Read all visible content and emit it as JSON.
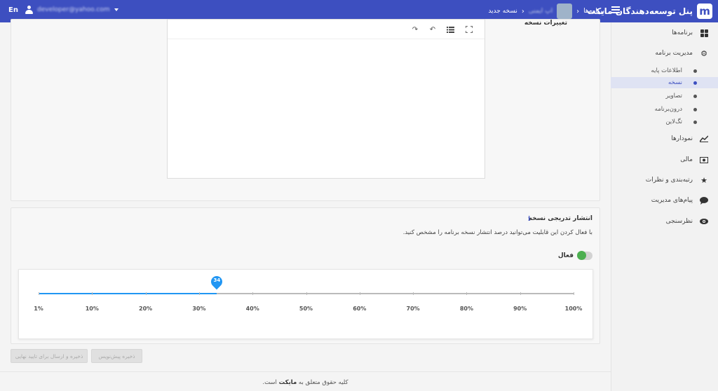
{
  "header": {
    "brand_title": "پنل توسعه‌دهندگان مایکت",
    "breadcrumb_apps": "برنامه‌ها",
    "breadcrumb_app_name": "اپ ایمنی",
    "breadcrumb_current": "نسخه جدید",
    "lang": "En",
    "user_email": "developer@yahoo.com"
  },
  "sidebar": {
    "items": [
      {
        "label": "برنامه‌ها",
        "icon": "grid-icon"
      },
      {
        "label": "مدیریت برنامه",
        "icon": "gear-icon"
      },
      {
        "label": "نمودارها",
        "icon": "chart-icon"
      },
      {
        "label": "مالی",
        "icon": "money-icon"
      },
      {
        "label": "رتبه‌بندی و نظرات",
        "icon": "star-icon"
      },
      {
        "label": "پیام‌های مدیریت",
        "icon": "chat-icon"
      },
      {
        "label": "نظرسنجی",
        "icon": "eye-icon"
      }
    ],
    "subitems": [
      {
        "label": "اطلاعات پایه"
      },
      {
        "label": "نسخه",
        "active": true
      },
      {
        "label": "تصاویر"
      },
      {
        "label": "درون‌برنامه"
      },
      {
        "label": "تگ‌لاین"
      }
    ]
  },
  "notes": {
    "title": "تغییرات نسخه"
  },
  "release": {
    "title": "انتشار تدریجی نسخه",
    "description": "با فعال کردن این قابلیت می‌توانید درصد انتشار نسخه برنامه را مشخص کنید.",
    "toggle_label": "فعال",
    "toggle_on": false,
    "slider_value": 34,
    "slider_value_label": "34",
    "ticks": [
      "1%",
      "10%",
      "20%",
      "30%",
      "40%",
      "50%",
      "60%",
      "70%",
      "80%",
      "90%",
      "100%"
    ],
    "accent_color": "#2196f3"
  },
  "buttons": {
    "save_draft": "ذخیره پیش‌نویس",
    "save_and_submit": "ذخیره و ارسال برای تایید نهایی"
  },
  "footer": {
    "text_before": "کلیه حقوق متعلق به",
    "brand": "مایکت",
    "text_after": "است."
  },
  "colors": {
    "header_bg": "#3d4fc0",
    "toggle_knob": "#4caf50"
  }
}
